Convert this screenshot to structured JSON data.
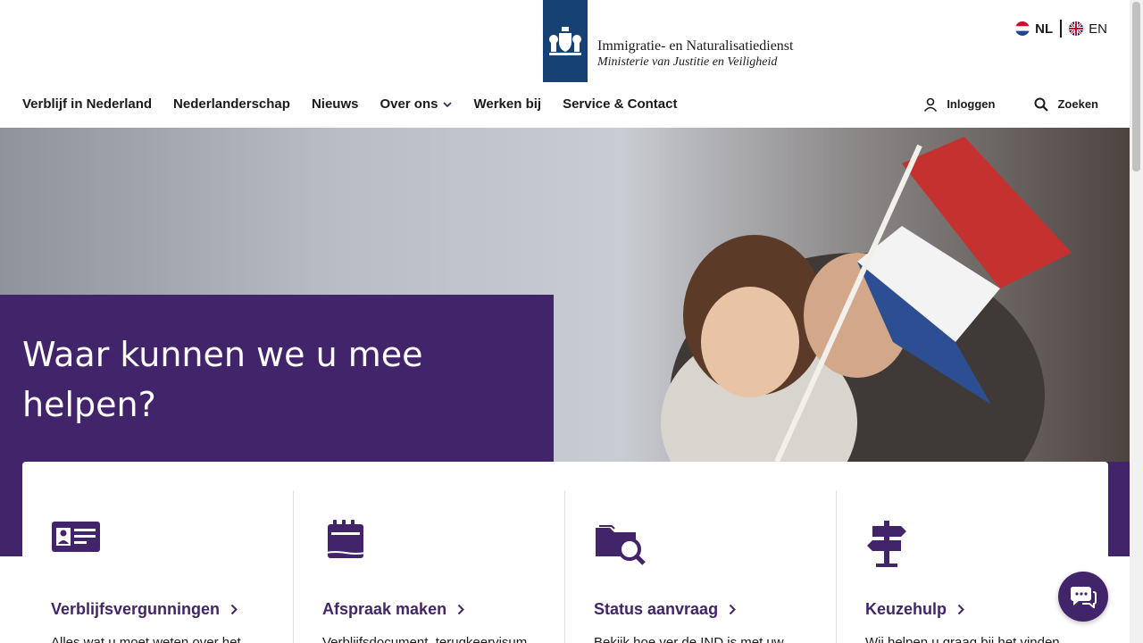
{
  "header": {
    "org_name": "Immigratie- en Naturalisatiedienst",
    "ministry": "Ministerie van Justitie en Veiligheid",
    "languages": [
      {
        "code": "NL",
        "active": true
      },
      {
        "code": "EN",
        "active": false
      }
    ]
  },
  "nav": {
    "items": [
      {
        "label": "Verblijf in Nederland"
      },
      {
        "label": "Nederlanderschap"
      },
      {
        "label": "Nieuws"
      },
      {
        "label": "Over ons",
        "has_dropdown": true
      },
      {
        "label": "Werken bij"
      },
      {
        "label": "Service & Contact"
      }
    ],
    "login_label": "Inloggen",
    "search_label": "Zoeken"
  },
  "hero": {
    "title": "Waar kunnen we u mee helpen?"
  },
  "cards": [
    {
      "icon": "id-card-icon",
      "title": "Verblijfsvergunningen",
      "text": "Alles wat u moet weten over het"
    },
    {
      "icon": "calendar-icon",
      "title": "Afspraak maken",
      "text": "Verblijfsdocument, terugkeervisum,"
    },
    {
      "icon": "folder-search-icon",
      "title": "Status aanvraag",
      "text": "Bekijk hoe ver de IND is met uw"
    },
    {
      "icon": "signpost-icon",
      "title": "Keuzehulp",
      "text": "Wij helpen u graag bij het vinden van"
    }
  ],
  "colors": {
    "brand_purple": "#42246a",
    "logo_blue": "#154273"
  }
}
